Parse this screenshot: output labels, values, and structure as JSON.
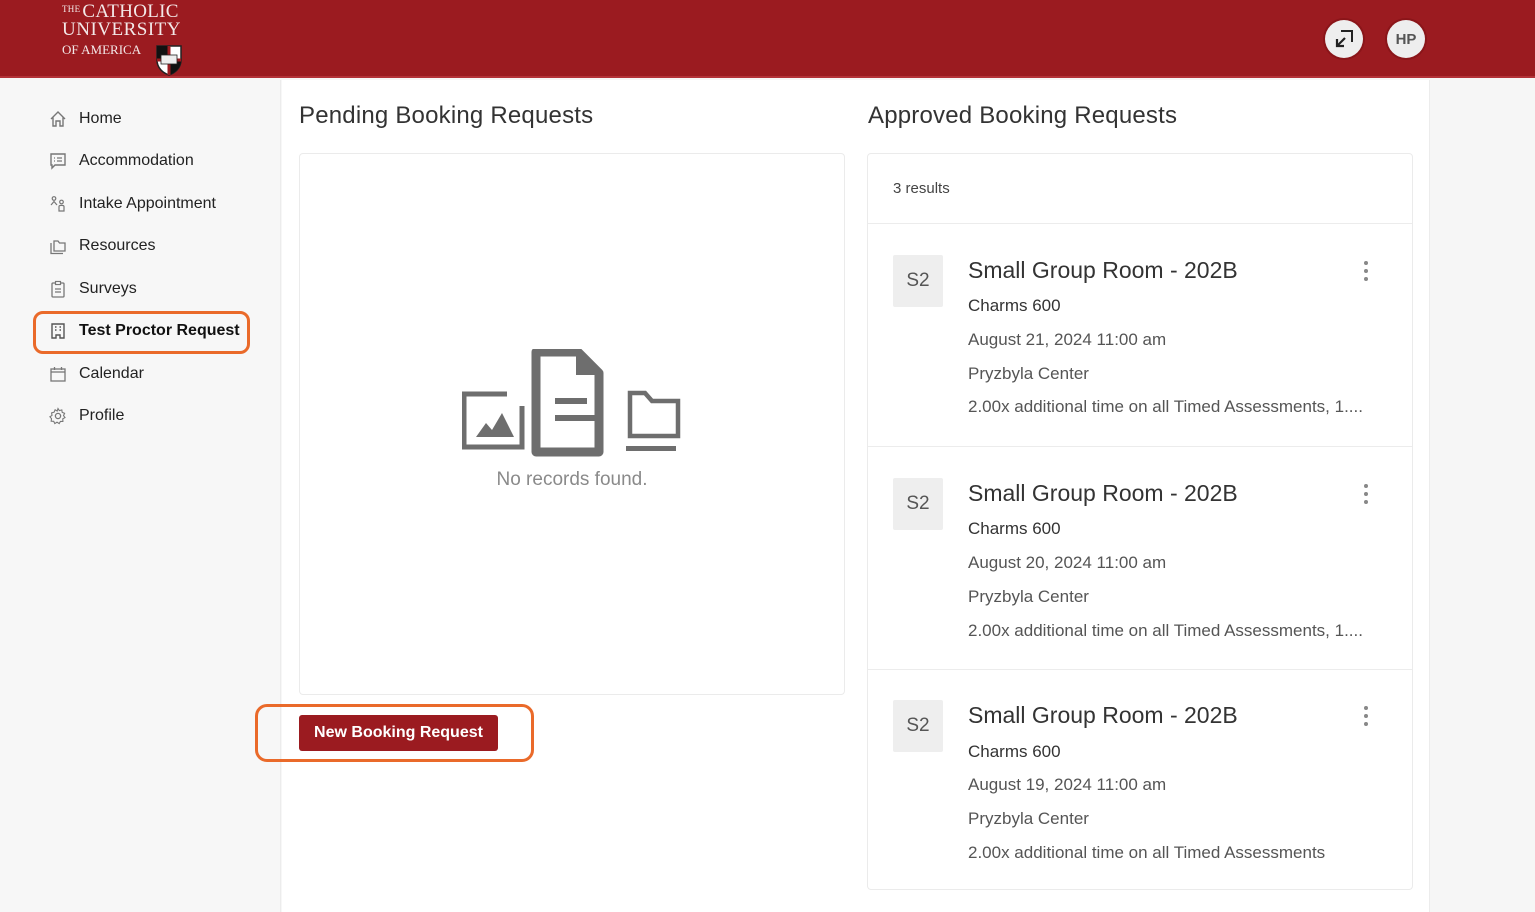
{
  "header": {
    "logo": {
      "line1_prefix": "THE",
      "line1": "CATHOLIC",
      "line2": "UNIVERSITY",
      "line3": "OF AMERICA"
    },
    "expand_button_icon": "expand-arrows-icon",
    "avatar_initials": "HP",
    "brand_color": "#9b1b20"
  },
  "sidebar": {
    "items": [
      {
        "label": "Home",
        "icon": "home-icon"
      },
      {
        "label": "Accommodation",
        "icon": "message-list-icon"
      },
      {
        "label": "Intake Appointment",
        "icon": "people-icon"
      },
      {
        "label": "Resources",
        "icon": "folders-icon"
      },
      {
        "label": "Surveys",
        "icon": "clipboard-icon"
      },
      {
        "label": "Test Proctor Request",
        "icon": "building-icon",
        "active": true
      },
      {
        "label": "Calendar",
        "icon": "calendar-icon"
      },
      {
        "label": "Profile",
        "icon": "gear-icon"
      }
    ]
  },
  "pending": {
    "title": "Pending Booking Requests",
    "empty_text": "No records found.",
    "new_button_label": "New Booking Request"
  },
  "approved": {
    "title": "Approved Booking Requests",
    "results_count": "3 results",
    "bookings": [
      {
        "avatar": "S2",
        "room": "Small Group Room - 202B",
        "course": "Charms 600",
        "datetime": "August 21, 2024 11:00 am",
        "location": "Pryzbyla Center",
        "accommodation": "2.00x additional time on all Timed Assessments, 1...."
      },
      {
        "avatar": "S2",
        "room": "Small Group Room - 202B",
        "course": "Charms 600",
        "datetime": "August 20, 2024 11:00 am",
        "location": "Pryzbyla Center",
        "accommodation": "2.00x additional time on all Timed Assessments, 1...."
      },
      {
        "avatar": "S2",
        "room": "Small Group Room - 202B",
        "course": "Charms 600",
        "datetime": "August 19, 2024 11:00 am",
        "location": "Pryzbyla Center",
        "accommodation": "2.00x additional time on all Timed Assessments"
      }
    ]
  },
  "annotations": {
    "highlight_color": "#ea6a2a"
  }
}
